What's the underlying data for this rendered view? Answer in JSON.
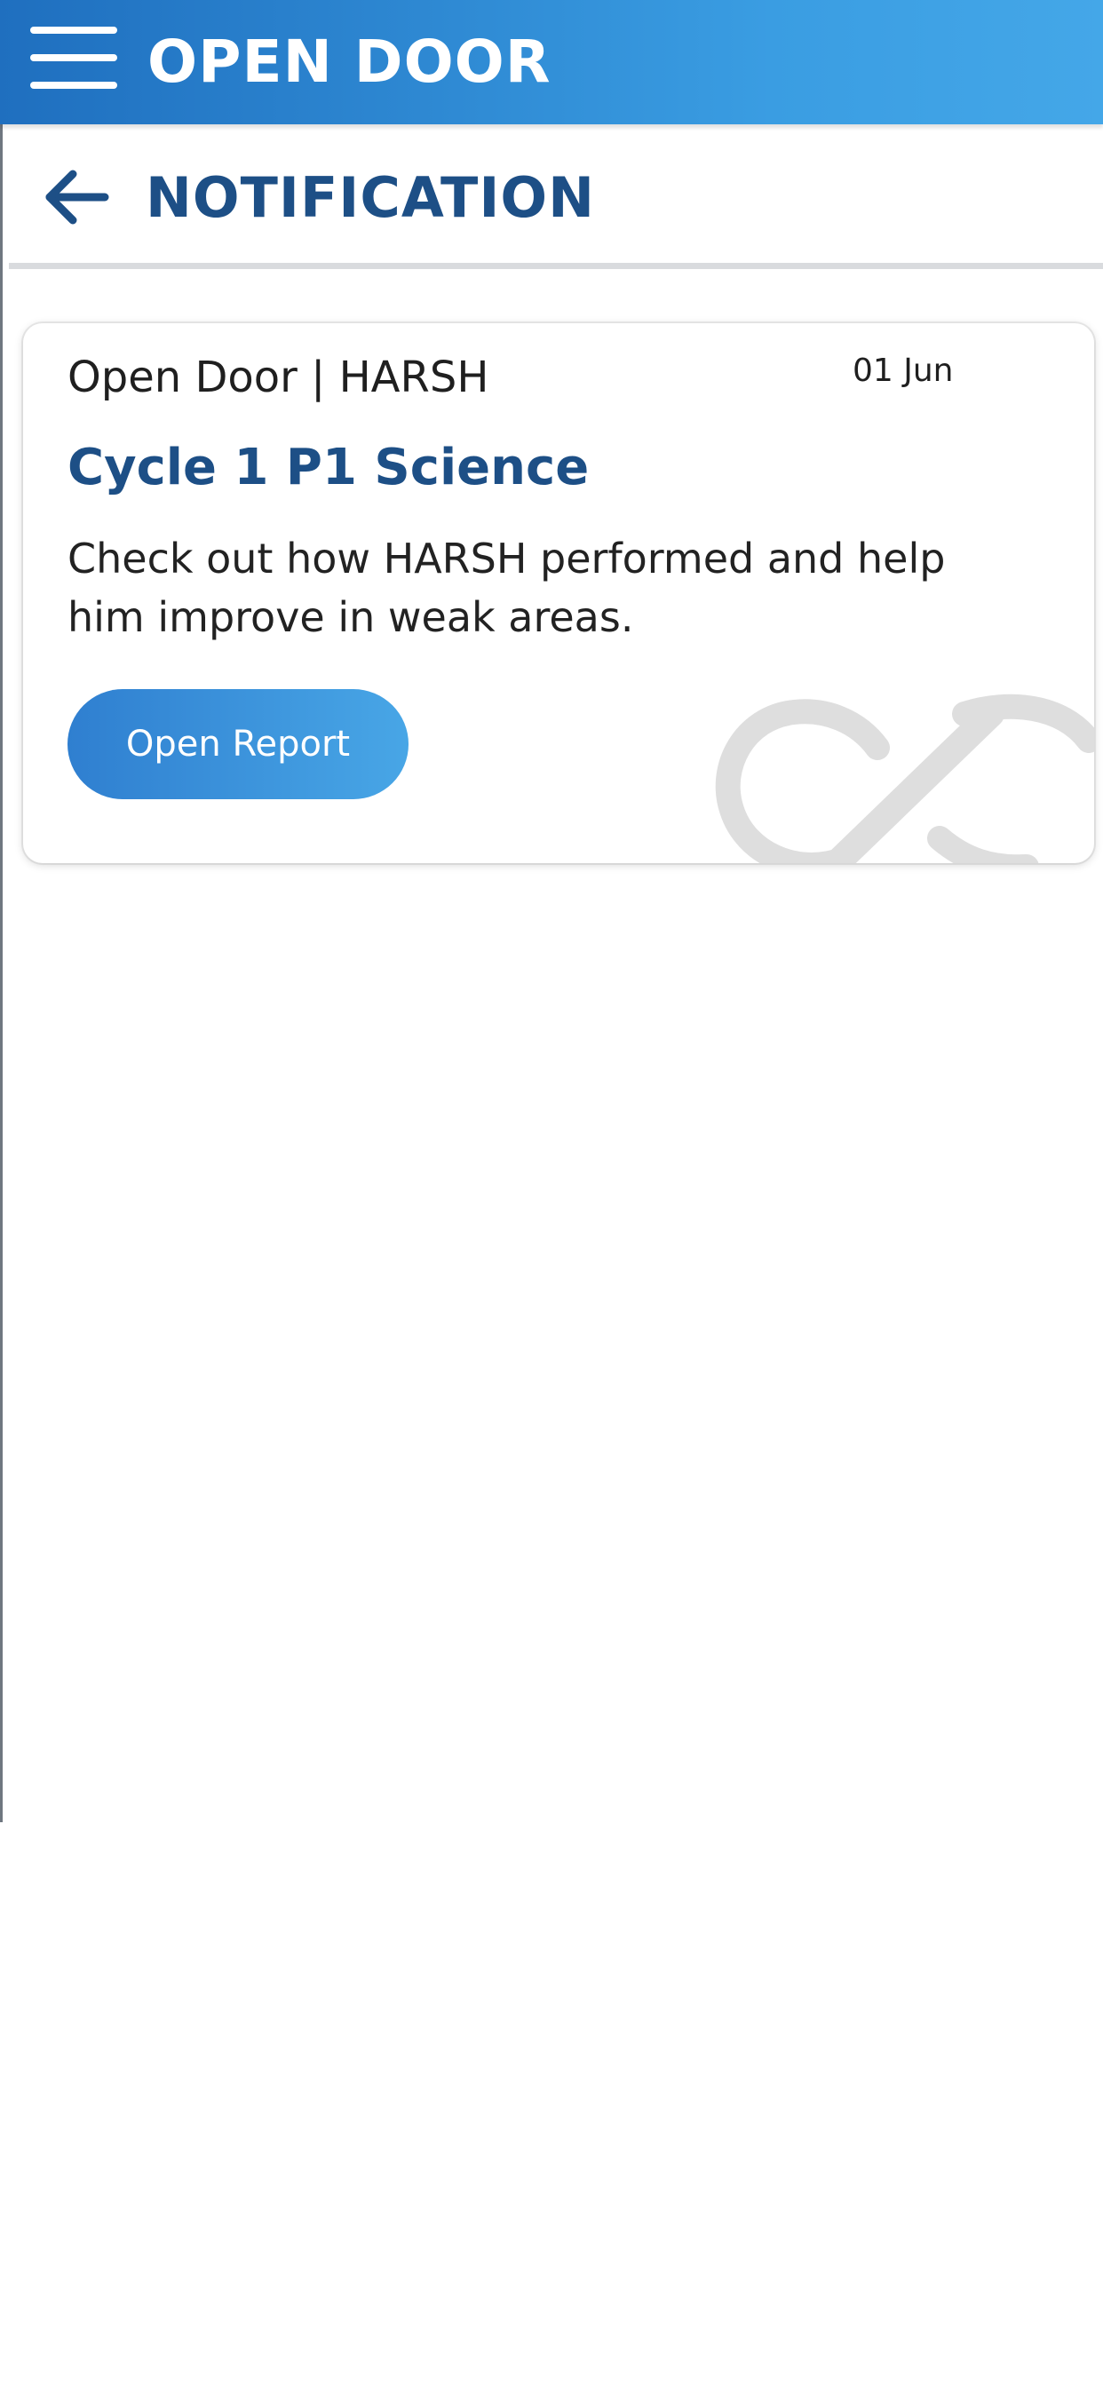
{
  "app_bar": {
    "menu_icon": "hamburger-menu-icon",
    "title": "OPEN DOOR",
    "accent_start": "#1f6fbf",
    "accent_end": "#44a7e8"
  },
  "header": {
    "back_icon": "arrow-left-icon",
    "title": "NOTIFICATION",
    "title_color": "#1d4f86"
  },
  "notifications": [
    {
      "source": "Open Door | HARSH",
      "date": "01 Jun",
      "title": "Cycle 1 P1 Science",
      "body": "Check out how HARSH performed and help him improve in weak areas.",
      "action_label": "Open Report",
      "watermark_icon": "open-door-logo-watermark"
    }
  ]
}
